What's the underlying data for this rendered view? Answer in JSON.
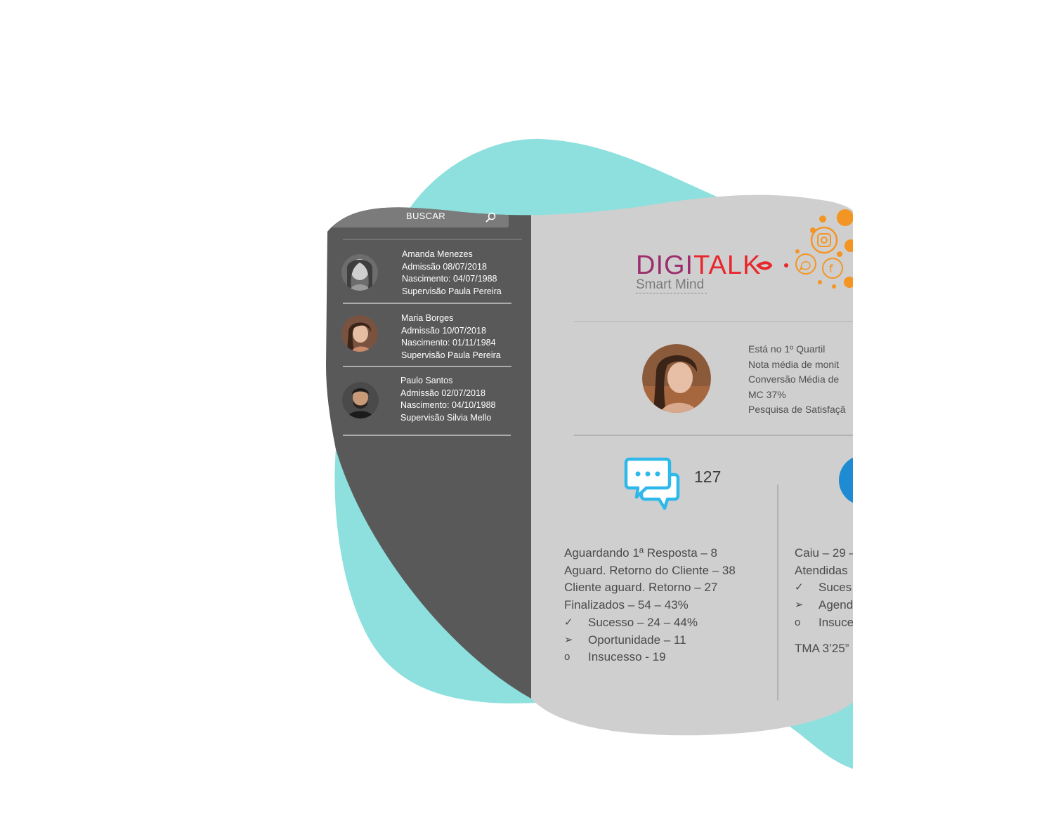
{
  "search": {
    "label": "BUSCAR"
  },
  "employees": [
    {
      "name": "Amanda Menezes",
      "admission": "Admissão 08/07/2018",
      "birth": "Nascimento: 04/07/1988",
      "supervision": "Supervisão Paula Pereira"
    },
    {
      "name": "Maria Borges",
      "admission": "Admissão 10/07/2018",
      "birth": "Nascimento: 01/11/1984",
      "supervision": "Supervisão Paula Pereira"
    },
    {
      "name": "Paulo Santos",
      "admission": "Admissão 02/07/2018",
      "birth": "Nascimento: 04/10/1988",
      "supervision": "Supervisão Silvia Mello"
    }
  ],
  "logo": {
    "part1": "DIGI",
    "part2": "TALK",
    "tagline": "Smart Mind"
  },
  "profile": {
    "lines": [
      "Está no 1º Quartil",
      "Nota média de monit",
      "Conversão Média de",
      "MC 37%",
      "Pesquisa de Satisfaçã"
    ]
  },
  "chat": {
    "count": "127",
    "lines": [
      "Aguardando 1ª Resposta – 8",
      "Aguard. Retorno do Cliente – 38",
      "Cliente aguard. Retorno – 27",
      "Finalizados – 54 – 43%"
    ],
    "sub_items": [
      {
        "bullet": "✓",
        "text": "Sucesso – 24 – 44%"
      },
      {
        "bullet": "➢",
        "text": "Oportunidade – 11"
      },
      {
        "bullet": "o",
        "text": "Insucesso - 19"
      }
    ]
  },
  "calls": {
    "lines": [
      "Caiu – 29 –",
      "Atendidas"
    ],
    "sub_items": [
      {
        "bullet": "✓",
        "text": "Suces"
      },
      {
        "bullet": "➢",
        "text": "Agend"
      },
      {
        "bullet": "o",
        "text": "Insuce"
      }
    ],
    "tma": "TMA 3’25”"
  },
  "colors": {
    "teal": "#8de0dd",
    "sidebar": "#595959",
    "panel": "#d0cfcf",
    "logo_purple": "#9b2f6e",
    "logo_red": "#e8262b",
    "orange": "#f39523",
    "chat_blue": "#2fb9ea",
    "call_blue": "#1e8bd2"
  }
}
